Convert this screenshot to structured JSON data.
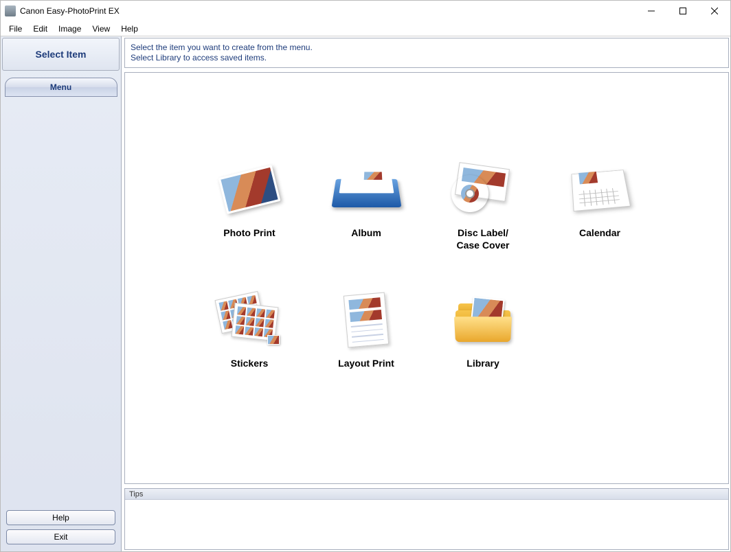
{
  "app_title": "Canon Easy-PhotoPrint EX",
  "menubar": {
    "file": "File",
    "edit": "Edit",
    "image": "Image",
    "view": "View",
    "help": "Help"
  },
  "sidebar": {
    "header": "Select Item",
    "tab_menu": "Menu",
    "help_button": "Help",
    "exit_button": "Exit"
  },
  "instruction": {
    "line1": "Select the item you want to create from the menu.",
    "line2": "Select Library to access saved items."
  },
  "items": {
    "photo_print": "Photo Print",
    "album": "Album",
    "disc_label": "Disc Label/\nCase Cover",
    "calendar": "Calendar",
    "stickers": "Stickers",
    "layout_print": "Layout Print",
    "library": "Library"
  },
  "tips_label": "Tips"
}
